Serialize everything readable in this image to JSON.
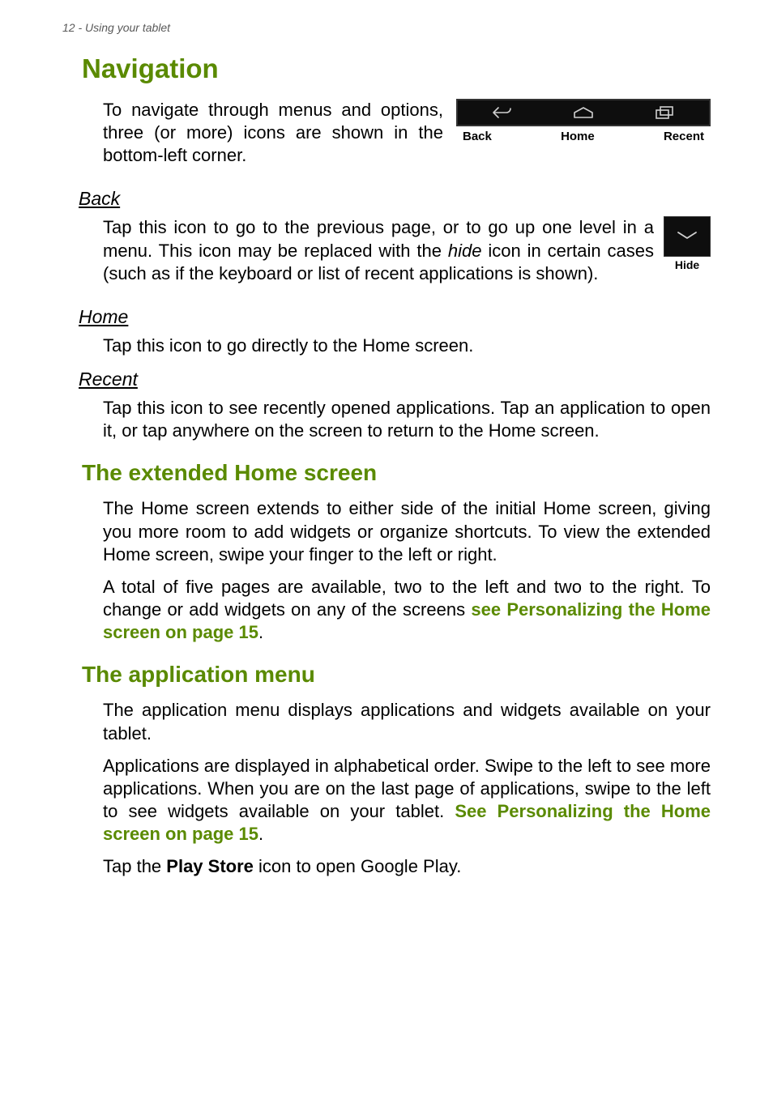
{
  "header": {
    "running": "12 - Using your tablet"
  },
  "nav": {
    "title": "Navigation",
    "intro": "To navigate through menus and options, three (or more) icons are shown in the bottom-left corner.",
    "icons": {
      "back_label": "Back",
      "home_label": "Home",
      "recent_label": "Recent"
    },
    "hide_label": "Hide",
    "back": {
      "heading": "Back",
      "text_before_italic": "Tap this icon to go to the previous page, or to go up one level in a menu. This icon may be replaced with the ",
      "italic_word": "hide",
      "text_after_italic": " icon in certain cases (such as if the keyboard or list of recent applications is shown)."
    },
    "home": {
      "heading": "Home",
      "text": "Tap this icon to go directly to the Home screen."
    },
    "recent": {
      "heading": "Recent",
      "text": "Tap this icon to see recently opened applications. Tap an application to open it, or tap anywhere on the screen to return to the Home screen."
    }
  },
  "extended": {
    "title": "The extended Home screen",
    "p1": "The Home screen extends to either side of the initial Home screen, giving you more room to add widgets or organize shortcuts. To view the extended Home screen, swipe your finger to the left or right.",
    "p2_before_link": "A total of five pages are available, two to the left and two to the right. To change or add widgets on any of the screens ",
    "p2_link": "see Personalizing the Home screen on page 15",
    "p2_after_link": "."
  },
  "appmenu": {
    "title": "The application menu",
    "p1": "The application menu displays applications and widgets available on your tablet.",
    "p2_before_link": "Applications are displayed in alphabetical order. Swipe to the left to see more applications. When you are on the last page of applications, swipe to the left to see widgets available on your tablet. ",
    "p2_link": "See Personalizing the Home screen on page 15",
    "p2_after_link": ".",
    "p3_before_bold": "Tap the ",
    "p3_bold": "Play Store",
    "p3_after_bold": " icon to open Google Play."
  }
}
